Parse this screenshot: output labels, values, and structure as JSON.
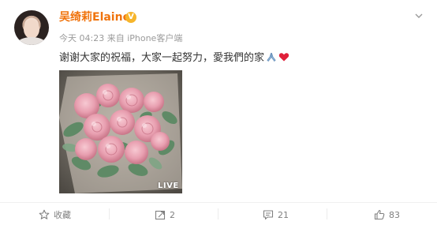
{
  "post": {
    "author": "吴绮莉Elaine",
    "verified_badge": "V",
    "meta": "今天 04:23 来自 iPhone客户端",
    "text": "谢谢大家的祝福，大家一起努力，愛我們的家",
    "media_badge": "LIVE"
  },
  "actions": {
    "favorite_label": "收藏",
    "repost_count": "2",
    "comment_count": "21",
    "like_count": "83"
  },
  "icons": [
    "chevron-down-icon",
    "pray-emoji-icon",
    "heart-emoji-icon",
    "star-icon",
    "repost-icon",
    "comment-icon",
    "like-icon"
  ],
  "colors": {
    "author": "#f0730c",
    "verified": "#f6b52b",
    "meta": "#9a9a9a",
    "action": "#808080"
  }
}
